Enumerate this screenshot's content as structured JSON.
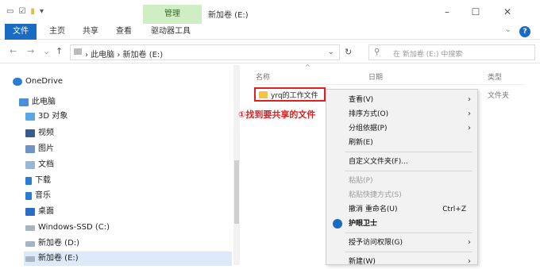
{
  "title_bar": {
    "manage_tab": "管理",
    "window_title": "新加卷 (E:)",
    "minimize": "–",
    "maximize": "☐",
    "close": "✕"
  },
  "ribbon": {
    "tabs": [
      "文件",
      "主页",
      "共享",
      "查看",
      "驱动器工具"
    ],
    "expand": "⌄",
    "help": "?"
  },
  "address_bar": {
    "back": "←",
    "forward": "→",
    "recent": "⌄",
    "up": "↑",
    "crumbs": "› 此电脑 › 新加卷 (E:)",
    "dropdown": "⌄",
    "refresh": "↻",
    "search_placeholder": "在 新加卷 (E:) 中搜索"
  },
  "sidebar": {
    "items": [
      {
        "label": "OneDrive",
        "icon": "cloud-icon"
      },
      {
        "label": "此电脑",
        "icon": "computer-icon"
      },
      {
        "label": "3D 对象",
        "icon": "3d-objects-icon"
      },
      {
        "label": "视频",
        "icon": "video-icon"
      },
      {
        "label": "图片",
        "icon": "pictures-icon"
      },
      {
        "label": "文档",
        "icon": "documents-icon"
      },
      {
        "label": "下载",
        "icon": "download-icon"
      },
      {
        "label": "音乐",
        "icon": "music-icon"
      },
      {
        "label": "桌面",
        "icon": "desktop-icon"
      },
      {
        "label": "Windows-SSD (C:)",
        "icon": "drive-icon"
      },
      {
        "label": "新加卷 (D:)",
        "icon": "drive-icon"
      },
      {
        "label": "新加卷 (E:)",
        "icon": "drive-icon"
      }
    ]
  },
  "columns": {
    "name": "名称",
    "date": "日期",
    "type": "类型"
  },
  "file": {
    "name": "yrq的工作文件",
    "type": "文件夹"
  },
  "annotation": "①找到要共享的文件",
  "context_menu": {
    "items": [
      {
        "label": "查看(V)",
        "arrow": "›"
      },
      {
        "label": "排序方式(O)",
        "arrow": "›"
      },
      {
        "label": "分组依据(P)",
        "arrow": "›"
      },
      {
        "label": "刷新(E)"
      },
      {
        "label": "自定义文件夹(F)..."
      },
      {
        "label": "粘贴(P)"
      },
      {
        "label": "粘贴快捷方式(S)"
      },
      {
        "label": "撤消 重命名(U)",
        "shortcut": "Ctrl+Z"
      },
      {
        "label": "护眼卫士"
      },
      {
        "label": "授予访问权限(G)",
        "arrow": "›"
      },
      {
        "label": "新建(W)",
        "arrow": "›"
      }
    ]
  },
  "colors": {
    "accent_blue": "#1a6bc4",
    "manage_green": "#cfeec3",
    "highlight_red": "#e02020",
    "folder_yellow": "#f3c24a"
  }
}
